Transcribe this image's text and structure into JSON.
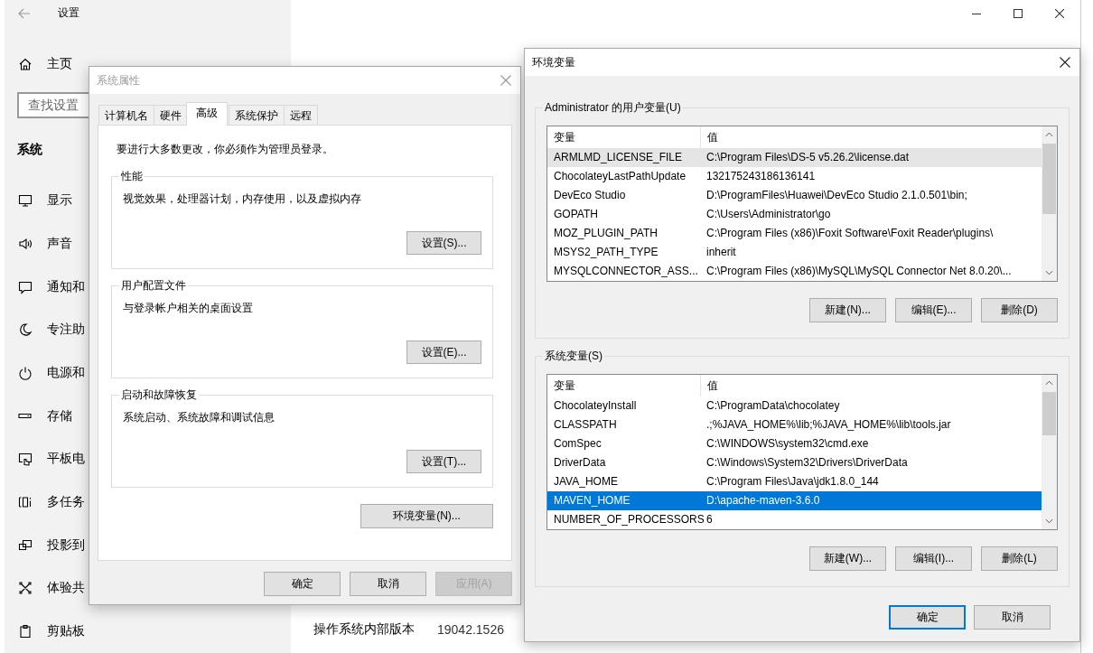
{
  "settings": {
    "title": "设置",
    "home": "主页",
    "search": {
      "placeholder": "查找设置"
    },
    "section": "系统",
    "nav": [
      {
        "kind": "display",
        "label": "显示"
      },
      {
        "kind": "sound",
        "label": "声音"
      },
      {
        "kind": "notification",
        "label": "通知和"
      },
      {
        "kind": "focus",
        "label": "专注助"
      },
      {
        "kind": "power",
        "label": "电源和"
      },
      {
        "kind": "storage",
        "label": "存储"
      },
      {
        "kind": "tablet",
        "label": "平板电"
      },
      {
        "kind": "multitask",
        "label": "多任务"
      },
      {
        "kind": "project",
        "label": "投影到"
      },
      {
        "kind": "share",
        "label": "体验共"
      },
      {
        "kind": "clipboard",
        "label": "剪贴板"
      }
    ],
    "info": [
      {
        "label": "操作系统内部版本",
        "value": "19042.1526"
      }
    ]
  },
  "system_properties": {
    "title": "系统属性",
    "tabs": [
      {
        "label": "计算机名",
        "selected": false
      },
      {
        "label": "硬件",
        "selected": false
      },
      {
        "label": "高级",
        "selected": true
      },
      {
        "label": "系统保护",
        "selected": false
      },
      {
        "label": "远程",
        "selected": false
      }
    ],
    "notice": "要进行大多数更改，你必须作为管理员登录。",
    "groups": [
      {
        "title": "性能",
        "description": "视觉效果，处理器计划，内存使用，以及虚拟内存",
        "button": "设置(S)..."
      },
      {
        "title": "用户配置文件",
        "description": "与登录帐户相关的桌面设置",
        "button": "设置(E)..."
      },
      {
        "title": "启动和故障恢复",
        "description": "系统启动、系统故障和调试信息",
        "button": "设置(T)..."
      }
    ],
    "env_button": "环境变量(N)...",
    "buttons": [
      {
        "label": "确定",
        "disabled": false
      },
      {
        "label": "取消",
        "disabled": false
      },
      {
        "label": "应用(A)",
        "disabled": true
      }
    ]
  },
  "environment_variables": {
    "title": "环境变量",
    "lists": [
      {
        "title": "Administrator 的用户变量(U)",
        "columns": [
          "变量",
          "值"
        ],
        "rows": [
          {
            "name": "ARMLMD_LICENSE_FILE",
            "value": "C:\\Program Files\\DS-5 v5.26.2\\license.dat",
            "selected": false,
            "hovered": true
          },
          {
            "name": "ChocolateyLastPathUpdate",
            "value": "132175243186136141",
            "selected": false,
            "hovered": false
          },
          {
            "name": "DevEco Studio",
            "value": "D:\\ProgramFiles\\Huawei\\DevEco Studio 2.1.0.501\\bin;",
            "selected": false,
            "hovered": false
          },
          {
            "name": "GOPATH",
            "value": "C:\\Users\\Administrator\\go",
            "selected": false,
            "hovered": false
          },
          {
            "name": "MOZ_PLUGIN_PATH",
            "value": "C:\\Program Files (x86)\\Foxit Software\\Foxit Reader\\plugins\\",
            "selected": false,
            "hovered": false
          },
          {
            "name": "MSYS2_PATH_TYPE",
            "value": "inherit",
            "selected": false,
            "hovered": false
          },
          {
            "name": "MYSQLCONNECTOR_ASS...",
            "value": "C:\\Program Files (x86)\\MySQL\\MySQL Connector Net 8.0.20\\...",
            "selected": false,
            "hovered": false
          }
        ],
        "buttons": [
          "新建(N)...",
          "编辑(E)...",
          "删除(D)"
        ]
      },
      {
        "title": "系统变量(S)",
        "columns": [
          "变量",
          "值"
        ],
        "rows": [
          {
            "name": "ChocolateyInstall",
            "value": "C:\\ProgramData\\chocolatey",
            "selected": false,
            "hovered": false
          },
          {
            "name": "CLASSPATH",
            "value": ".;%JAVA_HOME%\\lib;%JAVA_HOME%\\lib\\tools.jar",
            "selected": false,
            "hovered": false
          },
          {
            "name": "ComSpec",
            "value": "C:\\WINDOWS\\system32\\cmd.exe",
            "selected": false,
            "hovered": false
          },
          {
            "name": "DriverData",
            "value": "C:\\Windows\\System32\\Drivers\\DriverData",
            "selected": false,
            "hovered": false
          },
          {
            "name": "JAVA_HOME",
            "value": "C:\\Program Files\\Java\\jdk1.8.0_144",
            "selected": false,
            "hovered": false
          },
          {
            "name": "MAVEN_HOME",
            "value": "D:\\apache-maven-3.6.0",
            "selected": true,
            "hovered": false
          },
          {
            "name": "NUMBER_OF_PROCESSORS",
            "value": "6",
            "selected": false,
            "hovered": false
          }
        ],
        "buttons": [
          "新建(W)...",
          "编辑(I)...",
          "删除(L)"
        ]
      }
    ],
    "buttons": [
      {
        "label": "确定",
        "default": true
      },
      {
        "label": "取消",
        "default": false
      }
    ]
  }
}
